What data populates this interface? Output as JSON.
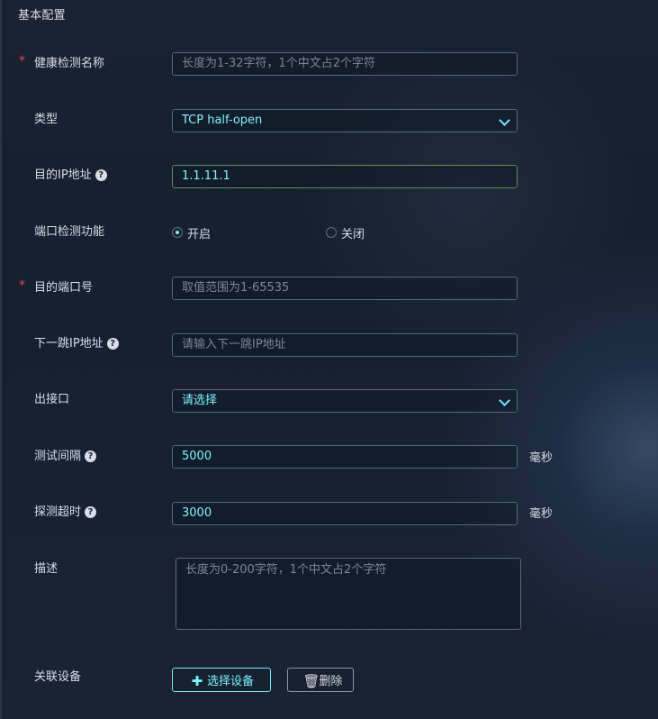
{
  "section": {
    "title": "基本配置"
  },
  "fields": {
    "health_check_name": {
      "required_mark": "*",
      "label": "健康检测名称",
      "placeholder": "长度为1-32字符，1个中文占2个字符"
    },
    "type": {
      "label": "类型",
      "value": "TCP half-open"
    },
    "destination_ip": {
      "label": "目的IP地址",
      "value": "1.1.11.1",
      "help_icon": "question-circle-icon"
    },
    "port_check": {
      "label": "端口检测功能",
      "options": [
        {
          "label": "开启",
          "checked": true
        },
        {
          "label": "关闭",
          "checked": false
        }
      ]
    },
    "destination_port": {
      "required_mark": "*",
      "label": "目的端口号",
      "placeholder": "取值范围为1-65535"
    },
    "next_hop": {
      "label": "下一跳IP地址",
      "placeholder": "请输入下一跳IP地址",
      "help_icon": "question-circle-icon"
    },
    "outbound_interface": {
      "label": "出接口",
      "value": "请选择"
    },
    "test_interval": {
      "label": "测试间隔",
      "value": "5000",
      "unit": "毫秒",
      "help_icon": "question-circle-icon"
    },
    "probe_timeout": {
      "label": "探测超时",
      "value": "3000",
      "unit": "毫秒",
      "help_icon": "question-circle-icon"
    },
    "description": {
      "label": "描述",
      "placeholder": "长度为0-200字符，1个中文占2个字符"
    },
    "associated_devices": {
      "label": "关联设备",
      "select_button": "选择设备",
      "delete_button": "删除",
      "select_icon": "plus-icon",
      "delete_icon": "trash-icon"
    }
  },
  "colors": {
    "accent": "#7cf4ff",
    "required": "#e84b4b",
    "border": "#4e6d79",
    "valid_border": "#5b8f56"
  }
}
